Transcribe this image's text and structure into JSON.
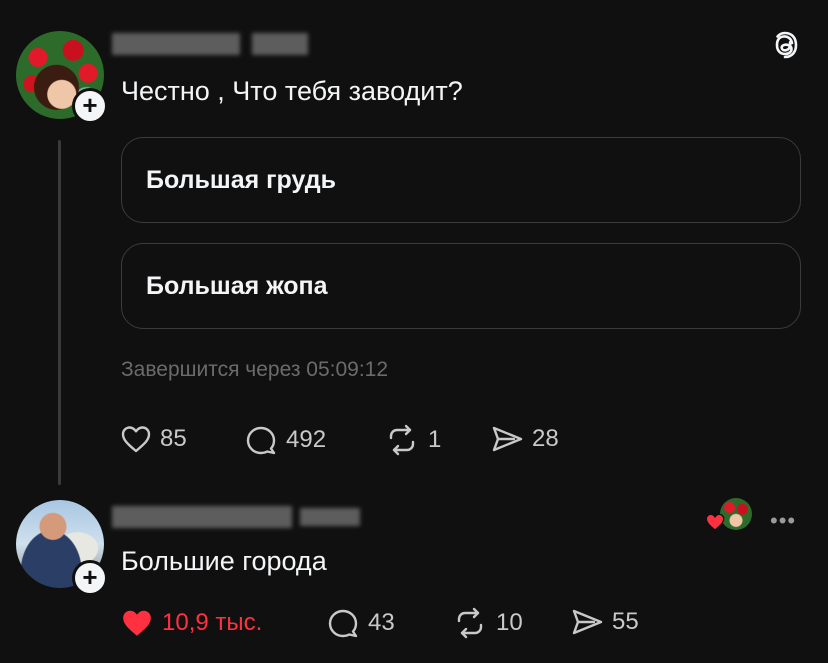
{
  "post": {
    "text": "Честно , Что тебя заводит?",
    "poll": {
      "options": [
        "Большая грудь",
        "Большая жопа"
      ],
      "ends_in": "Завершится через 05:09:12"
    },
    "actions": {
      "likes": "85",
      "comments": "492",
      "reposts": "1",
      "shares": "28"
    }
  },
  "reply": {
    "text": "Большие города",
    "actions": {
      "likes": "10,9 тыс.",
      "comments": "43",
      "reposts": "10",
      "shares": "55"
    },
    "more_label": "•••"
  },
  "icons": {
    "app_logo": "threads-logo-icon",
    "like": "heart-icon",
    "comment": "comment-bubble-icon",
    "repost": "repost-icon",
    "share": "share-send-icon",
    "follow": "plus-icon"
  },
  "colors": {
    "background": "#101010",
    "text": "#f3f5f7",
    "muted": "#6b6b6b",
    "liked": "#ff3040"
  }
}
